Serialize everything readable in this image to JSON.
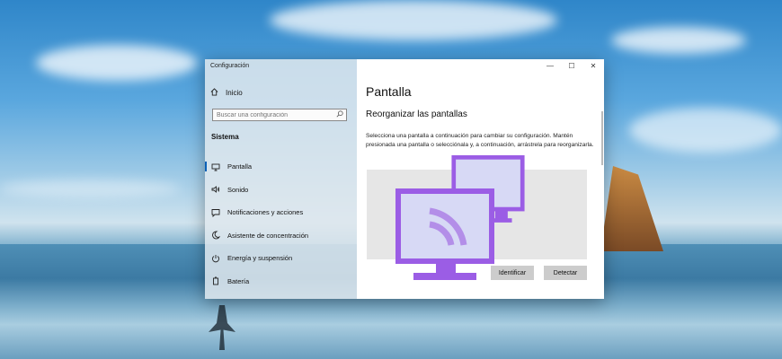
{
  "window": {
    "app_title": "Configuración",
    "controls": {
      "minimize": "—",
      "maximize": "☐",
      "close": "✕"
    }
  },
  "sidebar": {
    "home_label": "Inicio",
    "search_placeholder": "Buscar una configuración",
    "section_label": "Sistema",
    "items": [
      {
        "label": "Pantalla",
        "icon": "monitor-icon",
        "active": true
      },
      {
        "label": "Sonido",
        "icon": "speaker-icon"
      },
      {
        "label": "Notificaciones y acciones",
        "icon": "notification-icon"
      },
      {
        "label": "Asistente de concentración",
        "icon": "moon-icon"
      },
      {
        "label": "Energía y suspensión",
        "icon": "power-icon"
      },
      {
        "label": "Batería",
        "icon": "battery-icon"
      }
    ]
  },
  "main": {
    "page_title": "Pantalla",
    "section_title": "Reorganizar las pantallas",
    "description": "Selecciona una pantalla a continuación para cambiar su configuración. Mantén presionada una pantalla o selecciónala y, a continuación, arrástrela para reorganizarla.",
    "identify_button": "Identificar",
    "detect_button": "Detectar"
  },
  "colors": {
    "accent": "#0a61b7",
    "monitor_purple": "#9b5de5",
    "monitor_screen": "#d7d9f5"
  }
}
